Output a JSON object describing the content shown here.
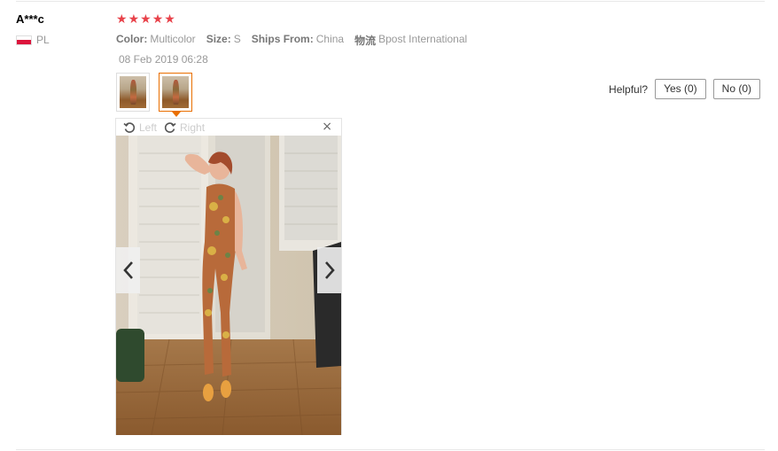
{
  "review": {
    "user_name": "A***c",
    "country_code": "PL",
    "rating": 5,
    "stars": [
      "★",
      "★",
      "★",
      "★",
      "★"
    ],
    "attributes": [
      {
        "key": "Color:",
        "value": "Multicolor"
      },
      {
        "key": "Size:",
        "value": "S"
      },
      {
        "key": "Ships From:",
        "value": "China"
      },
      {
        "key": "物流",
        "value": "Bpost International"
      }
    ],
    "date": "08 Feb 2019 06:28",
    "thumbnails_count": 2,
    "active_thumbnail": 2
  },
  "viewer": {
    "rotate_left_label": "Left",
    "rotate_right_label": "Right",
    "close_icon": "×"
  },
  "helpful": {
    "label": "Helpful?",
    "yes_label": "Yes (0)",
    "no_label": "No (0)"
  },
  "colors": {
    "star": "#e8424a",
    "active_thumb_border": "#e96f00"
  }
}
